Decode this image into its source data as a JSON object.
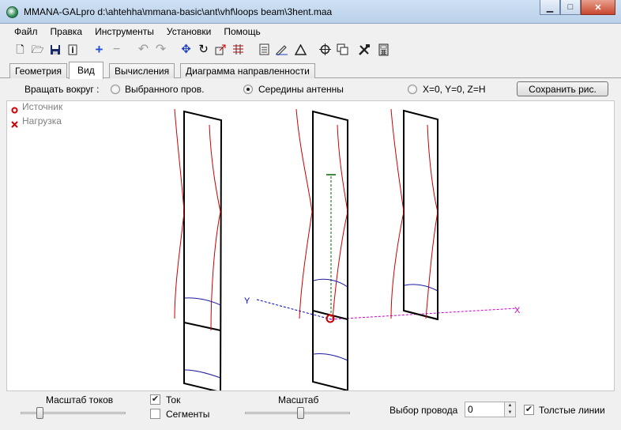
{
  "window": {
    "title": "MMANA-GALpro d:\\ahtehha\\mmana-basic\\ant\\vhf\\loops beam\\3hent.maa",
    "minimize": "▁",
    "maximize": "□",
    "close": "✕"
  },
  "menu": [
    "Файл",
    "Правка",
    "Инструменты",
    "Установки",
    "Помощь"
  ],
  "tabs": [
    "Геометрия",
    "Вид",
    "Вычисления",
    "Диаграмма направленности"
  ],
  "active_tab": "Вид",
  "options": {
    "rotate_label": "Вращать вокруг :",
    "radio_selected_wire": "Выбранного пров.",
    "radio_antenna_center": "Середины антенны",
    "radio_origin": "X=0, Y=0, Z=H",
    "selected_radio": "radio_antenna_center",
    "save_button": "Сохранить рис."
  },
  "legend": {
    "source": "Источник",
    "load": "Нагрузка",
    "source_color": "#cc0000",
    "load_color": "#cc0000"
  },
  "view": {
    "axis_y_label": "Y",
    "axis_x_label": "X",
    "wire_color": "#000000",
    "current_color": "#cc0000",
    "arc_color": "#1a1aa0",
    "y_axis_color": "#0000cc",
    "x_axis_color": "#cc00cc",
    "z_axis_color": "#006600"
  },
  "bottom": {
    "current_scale_label": "Масштаб токов",
    "current_scale_value": 0.18,
    "current_checkbox": "Ток",
    "current_checked": true,
    "segments_checkbox": "Сегменты",
    "segments_checked": false,
    "scale_label": "Масштаб",
    "scale_value": 0.53,
    "wire_select_label": "Выбор провода",
    "wire_select_value": "0",
    "thick_lines_checkbox": "Толстые линии",
    "thick_lines_checked": true
  }
}
